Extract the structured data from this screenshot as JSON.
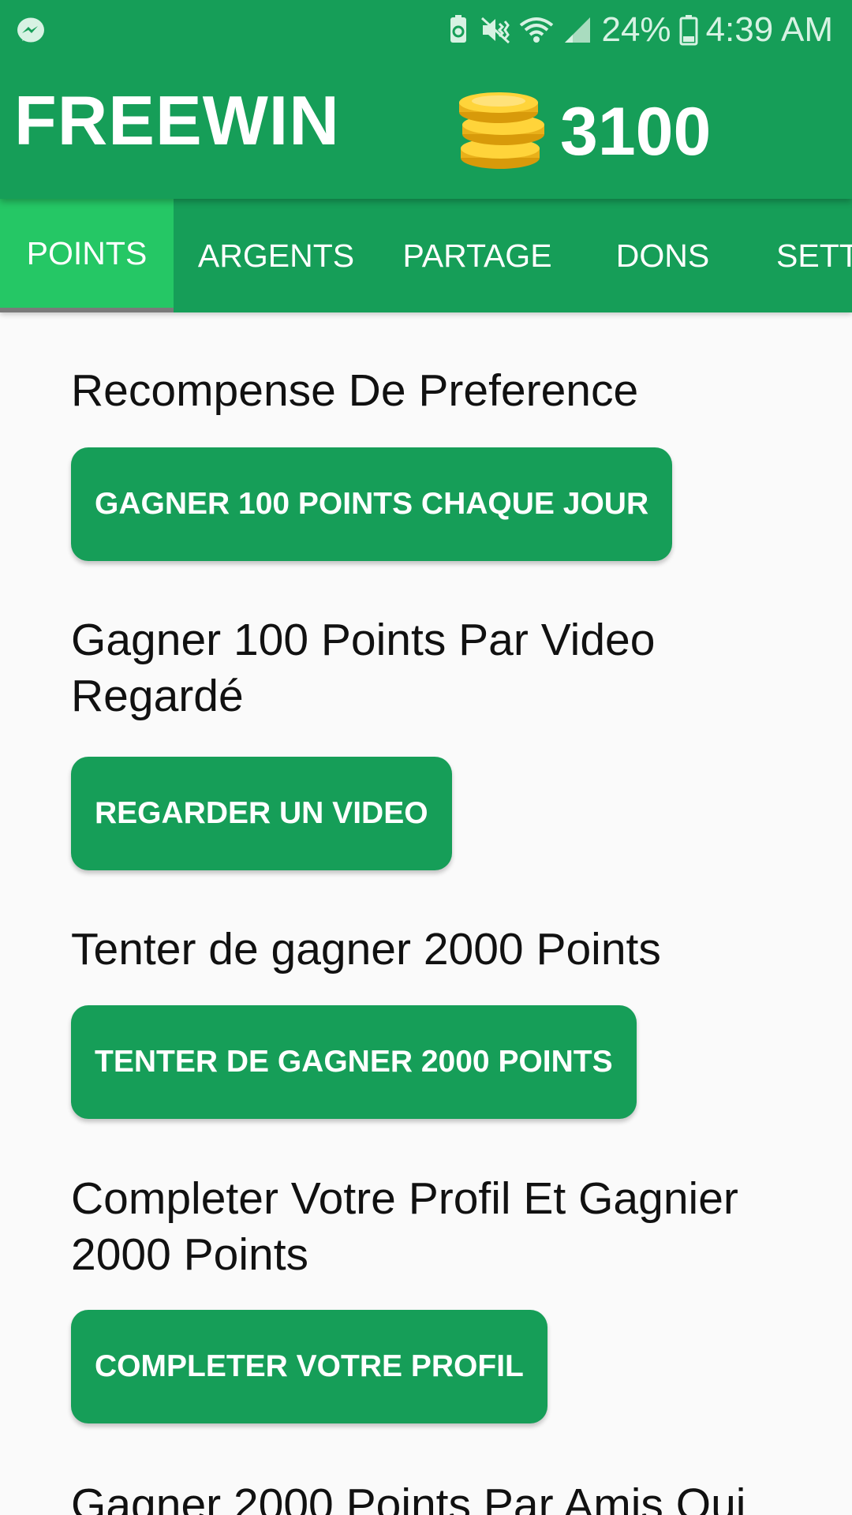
{
  "status_bar": {
    "battery_percent": "24%",
    "time": "4:39 AM",
    "icons": [
      "messenger-icon",
      "battery-saver-icon",
      "mute-vibrate-icon",
      "wifi-icon",
      "signal-icon",
      "battery-icon"
    ]
  },
  "app_bar": {
    "title": "FREEWIN",
    "points_balance": "3100",
    "coins_icon": "coins-icon"
  },
  "tabs": [
    {
      "label": "POINTS",
      "active": true
    },
    {
      "label": "ARGENTS",
      "active": false
    },
    {
      "label": "PARTAGE",
      "active": false
    },
    {
      "label": "DONS",
      "active": false
    },
    {
      "label": "SETT",
      "active": false
    }
  ],
  "sections": [
    {
      "title": "Recompense De Preference",
      "button_label": "GAGNER 100 POINTS CHAQUE JOUR"
    },
    {
      "title": "Gagner 100 Points Par Video Regardé",
      "button_label": "REGARDER UN VIDEO"
    },
    {
      "title": "Tenter de gagner 2000 Points",
      "button_label": "TENTER DE GAGNER 2000 POINTS"
    },
    {
      "title": "Completer Votre Profil Et Gagnier 2000 Points",
      "button_label": "COMPLETER VOTRE PROFIL"
    },
    {
      "title": "Gagner 2000 Points Par Amis Qui"
    }
  ],
  "colors": {
    "primary": "#169e58",
    "tab_active": "#25c765",
    "background": "#fafafa"
  }
}
